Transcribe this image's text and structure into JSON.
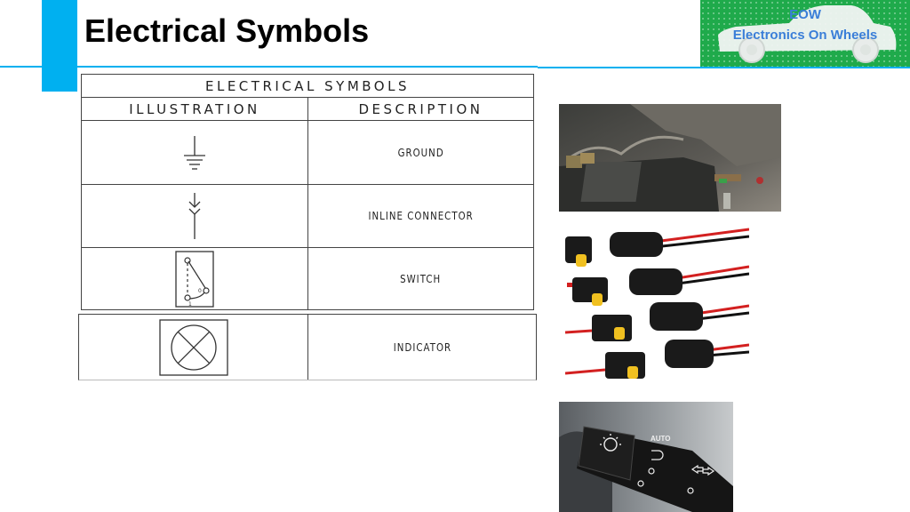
{
  "slide": {
    "title": "Electrical Symbols",
    "accent_color": "#00b0f0"
  },
  "logo": {
    "line1": "EOW",
    "line2": "Electronics On Wheels",
    "background_color": "#1faa4b",
    "text_color": "#3a7ed8"
  },
  "table": {
    "title": "ELECTRICAL SYMBOLS",
    "columns": [
      "ILLUSTRATION",
      "DESCRIPTION"
    ],
    "rows": [
      {
        "symbol": "ground-symbol",
        "description": "GROUND"
      },
      {
        "symbol": "inline-connector-symbol",
        "description": "INLINE CONNECTOR"
      },
      {
        "symbol": "switch-symbol",
        "description": "SWITCH",
        "labels": [
          "0",
          "1"
        ]
      },
      {
        "symbol": "indicator-symbol",
        "description": "INDICATOR"
      }
    ]
  },
  "photos": [
    {
      "name": "battery-ground-photo",
      "subject": "car battery ground cable"
    },
    {
      "name": "inline-connectors-photo",
      "subject": "waterproof inline wire connectors"
    },
    {
      "name": "headlight-switch-photo",
      "subject": "headlight stalk switch",
      "label": "AUTO"
    }
  ]
}
